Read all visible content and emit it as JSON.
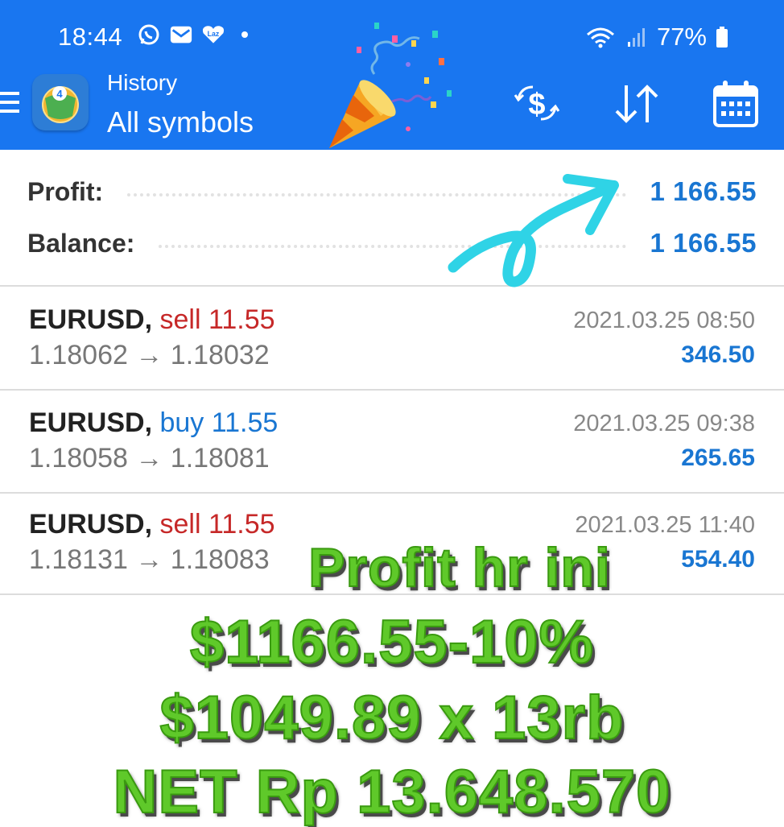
{
  "status_bar": {
    "time": "18:44",
    "battery": "77%",
    "icons": [
      "whatsapp-icon",
      "mail-icon",
      "lazada-icon",
      "wifi-icon",
      "signal-icon",
      "battery-icon"
    ]
  },
  "app_bar": {
    "subtitle": "History",
    "title": "All symbols",
    "actions": [
      "currency-exchange-icon",
      "sort-icon",
      "calendar-icon"
    ],
    "accent": "#1976f0"
  },
  "summary": {
    "profit_label": "Profit:",
    "profit_value": "1 166.55",
    "balance_label": "Balance:",
    "balance_value": "1 166.55"
  },
  "trades": [
    {
      "symbol": "EURUSD,",
      "side": "sell",
      "volume": "11.55",
      "prices": "1.18062 → 1.18032",
      "time": "2021.03.25 08:50",
      "profit": "346.50"
    },
    {
      "symbol": "EURUSD,",
      "side": "buy",
      "volume": "11.55",
      "prices": "1.18058 → 1.18081",
      "time": "2021.03.25 09:38",
      "profit": "265.65"
    },
    {
      "symbol": "EURUSD,",
      "side": "sell",
      "volume": "11.55",
      "prices": "1.18131 → 1.18083",
      "time": "2021.03.25 11:40",
      "profit": "554.40"
    }
  ],
  "overlay": {
    "line1": "Profit hr ini",
    "line2": "$1166.55-10%",
    "line3": "$1049.89 x 13rb",
    "line4": "NET Rp 13.648.570"
  }
}
